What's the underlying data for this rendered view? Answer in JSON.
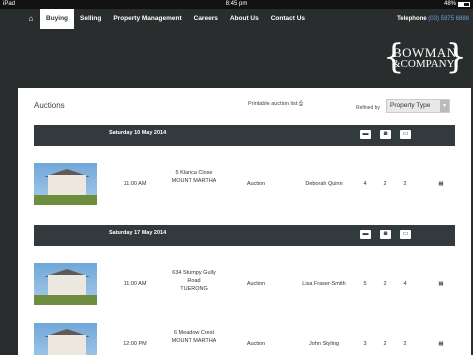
{
  "status": {
    "device": "iPad",
    "time": "8:45 pm",
    "battery": "48%"
  },
  "nav": {
    "items": [
      "Buying",
      "Selling",
      "Property Management",
      "Careers",
      "About Us",
      "Contact Us"
    ],
    "active": "Buying",
    "phone_label": "Telephone",
    "phone_number": "(03) 5975 6888"
  },
  "logo": {
    "line1": "BOWMAN",
    "line2": "&COMPANY"
  },
  "page": {
    "title": "Auctions",
    "printable": "Printable auction list",
    "refine_label": "Refined by",
    "filter_value": "Property Type"
  },
  "groups": [
    {
      "date": "Saturday 10 May 2014",
      "listings": [
        {
          "time": "11:00 AM",
          "address1": "5 Klarica Close",
          "address2": "MOUNT MARTHA",
          "address3": "",
          "method": "Auction",
          "agent": "Deborah Quinn",
          "beds": "4",
          "baths": "2",
          "cars": "2"
        }
      ]
    },
    {
      "date": "Saturday 17 May 2014",
      "listings": [
        {
          "time": "11:00 AM",
          "address1": "634 Stumpy Gully",
          "address2": "Road",
          "address3": "TUERONG",
          "method": "Auction",
          "agent": "Lisa Fraser-Smith",
          "beds": "5",
          "baths": "2",
          "cars": "4"
        },
        {
          "time": "12:00 PM",
          "address1": "6 Meadow Crest",
          "address2": "MOUNT MARTHA",
          "address3": "",
          "method": "Auction",
          "agent": "John Styling",
          "beds": "3",
          "baths": "2",
          "cars": "2"
        }
      ]
    }
  ],
  "icons": {
    "home": "home-icon",
    "print": "printer-icon",
    "bed": "bed-icon",
    "bath": "bath-icon",
    "car": "car-icon",
    "calendar": "calendar-icon"
  }
}
